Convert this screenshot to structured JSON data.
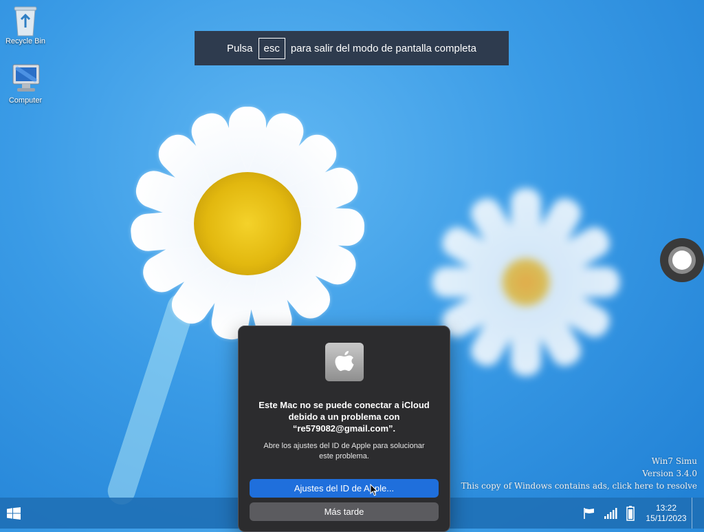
{
  "desktop": {
    "icons": [
      {
        "label": "Recycle Bin",
        "icon": "recycle-bin-icon"
      },
      {
        "label": "Computer",
        "icon": "computer-icon"
      }
    ]
  },
  "fullscreen_banner": {
    "prefix": "Pulsa",
    "key": "esc",
    "suffix": "para salir del modo de pantalla completa"
  },
  "dialog": {
    "icon": "apple-logo-icon",
    "title_line1": "Este Mac no se puede conectar a iCloud",
    "title_line2": "debido a un problema con",
    "title_line3": "“re579082@gmail.com”.",
    "message_line1": "Abre los ajustes del ID de Apple para solucionar",
    "message_line2": "este problema.",
    "primary_button": "Ajustes del ID de Apple...",
    "secondary_button": "Más tarde",
    "accent_color": "#1f6fdc"
  },
  "watermark": {
    "line1": "Win7 Simu",
    "line2": "Version 3.4.0",
    "line3": "This copy of Windows contains ads, click here to resolve"
  },
  "taskbar": {
    "start_icon": "windows-logo-icon",
    "tray_icons": [
      "flag-icon",
      "signal-icon",
      "battery-icon"
    ],
    "time": "13:22",
    "date": "15/11/2023"
  }
}
